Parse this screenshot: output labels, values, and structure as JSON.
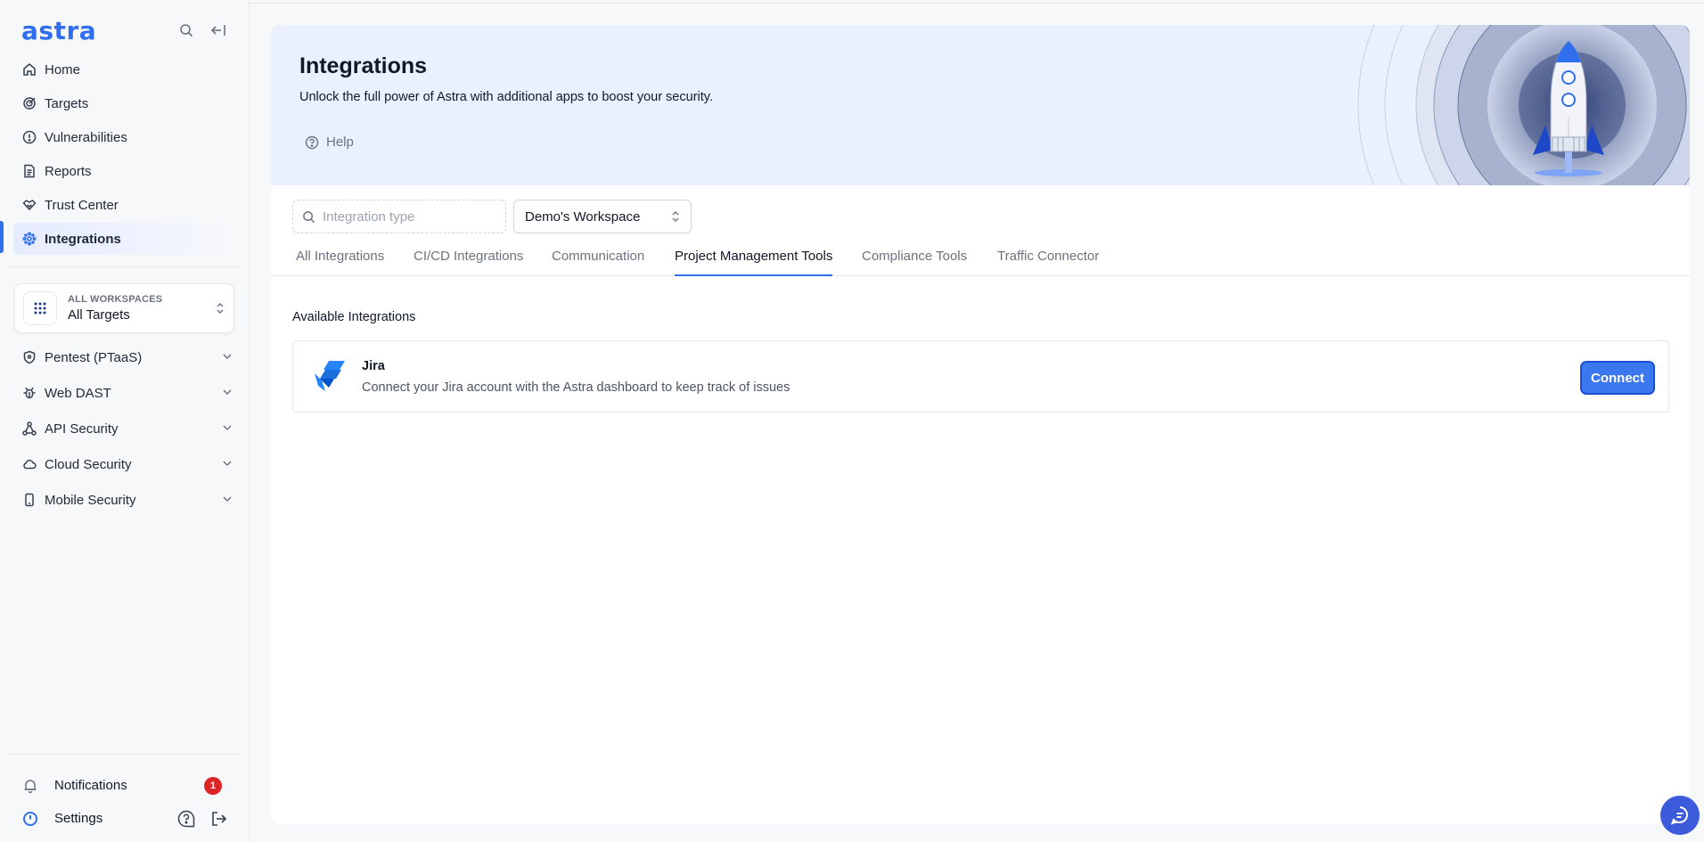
{
  "app": {
    "logo": "astra"
  },
  "sidebar": {
    "nav": [
      {
        "label": "Home",
        "icon": "home-icon"
      },
      {
        "label": "Targets",
        "icon": "target-icon"
      },
      {
        "label": "Vulnerabilities",
        "icon": "alert-circle-icon"
      },
      {
        "label": "Reports",
        "icon": "file-text-icon"
      },
      {
        "label": "Trust Center",
        "icon": "handshake-icon"
      },
      {
        "label": "Integrations",
        "icon": "integrations-icon",
        "active": true
      }
    ],
    "workspace": {
      "caption": "ALL WORKSPACES",
      "value": "All Targets"
    },
    "groups": [
      {
        "label": "Pentest (PTaaS)",
        "icon": "shield-icon"
      },
      {
        "label": "Web DAST",
        "icon": "bug-icon"
      },
      {
        "label": "API Security",
        "icon": "api-nodes-icon"
      },
      {
        "label": "Cloud Security",
        "icon": "cloud-icon"
      },
      {
        "label": "Mobile Security",
        "icon": "mobile-icon"
      }
    ],
    "bottom": {
      "notifications": {
        "label": "Notifications",
        "count": "1"
      },
      "settings": {
        "label": "Settings"
      }
    }
  },
  "header": {
    "title": "Integrations",
    "subtitle": "Unlock the full power of Astra with additional apps to boost your security.",
    "help_label": "Help"
  },
  "filters": {
    "search_placeholder": "Integration type",
    "search_value": "",
    "workspace_select": "Demo's Workspace"
  },
  "tabs": [
    {
      "label": "All Integrations"
    },
    {
      "label": "CI/CD Integrations"
    },
    {
      "label": "Communication"
    },
    {
      "label": "Project Management Tools",
      "active": true
    },
    {
      "label": "Compliance Tools"
    },
    {
      "label": "Traffic Connector"
    }
  ],
  "available": {
    "heading": "Available Integrations",
    "items": [
      {
        "name": "Jira",
        "description": "Connect your Jira account with the Astra dashboard to keep track of issues",
        "action_label": "Connect",
        "icon": "jira-icon"
      }
    ]
  },
  "colors": {
    "accent": "#2f6fed",
    "hero_bg": "#eaf0fd",
    "badge": "#dc2626",
    "chat_button": "#3b5bdb"
  }
}
